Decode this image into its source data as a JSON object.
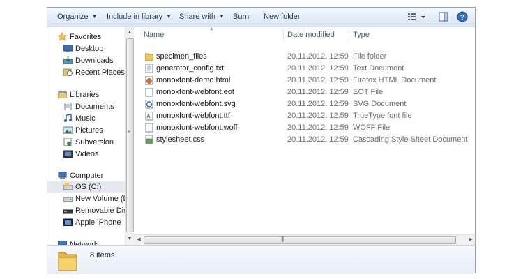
{
  "toolbar": {
    "organize": "Organize",
    "include_in_library": "Include in library",
    "share_with": "Share with",
    "burn": "Burn",
    "new_folder": "New folder",
    "icons": [
      "view-options-icon",
      "preview-pane-icon",
      "help-icon"
    ]
  },
  "nav": {
    "favorites": {
      "label": "Favorites",
      "items": [
        {
          "label": "Desktop",
          "icon": "desktop-icon"
        },
        {
          "label": "Downloads",
          "icon": "downloads-icon"
        },
        {
          "label": "Recent Places",
          "icon": "recent-places-icon"
        }
      ]
    },
    "libraries": {
      "label": "Libraries",
      "items": [
        {
          "label": "Documents",
          "icon": "documents-icon"
        },
        {
          "label": "Music",
          "icon": "music-icon"
        },
        {
          "label": "Pictures",
          "icon": "pictures-icon"
        },
        {
          "label": "Subversion",
          "icon": "subversion-icon"
        },
        {
          "label": "Videos",
          "icon": "videos-icon"
        }
      ]
    },
    "computer": {
      "label": "Computer",
      "items": [
        {
          "label": "OS (C:)",
          "icon": "drive-icon",
          "selected": true
        },
        {
          "label": "New Volume (D:)",
          "icon": "drive-icon"
        },
        {
          "label": "Removable Disk",
          "icon": "removable-disk-icon"
        },
        {
          "label": "Apple iPhone",
          "icon": "phone-icon"
        }
      ]
    },
    "network": {
      "label": "Network"
    }
  },
  "columns": {
    "name": "Name",
    "date": "Date modified",
    "type": "Type"
  },
  "files": [
    {
      "name": "specimen_files",
      "date": "20.11.2012. 12:59",
      "type": "File folder",
      "icon": "folder-icon"
    },
    {
      "name": "generator_config.txt",
      "date": "20.11.2012. 12:59",
      "type": "Text Document",
      "icon": "text-file-icon"
    },
    {
      "name": "monoxfont-demo.html",
      "date": "20.11.2012. 12:59",
      "type": "Firefox HTML Document",
      "icon": "firefox-html-icon"
    },
    {
      "name": "monoxfont-webfont.eot",
      "date": "20.11.2012. 12:59",
      "type": "EOT File",
      "icon": "blank-file-icon"
    },
    {
      "name": "monoxfont-webfont.svg",
      "date": "20.11.2012. 12:59",
      "type": "SVG Document",
      "icon": "svg-file-icon"
    },
    {
      "name": "monoxfont-webfont.ttf",
      "date": "20.11.2012. 12:59",
      "type": "TrueType font file",
      "icon": "font-file-icon"
    },
    {
      "name": "monoxfont-webfont.woff",
      "date": "20.11.2012. 12:59",
      "type": "WOFF File",
      "icon": "blank-file-icon"
    },
    {
      "name": "stylesheet.css",
      "date": "20.11.2012. 12:59",
      "type": "Cascading Style Sheet Document",
      "icon": "css-file-icon"
    }
  ],
  "details": {
    "count": "8 items",
    "icon": "folder-large-icon"
  },
  "colors": {
    "toolbar_text": "#1e395b",
    "header_text": "#4c607a",
    "selected_nav": "#e5e8ee"
  }
}
